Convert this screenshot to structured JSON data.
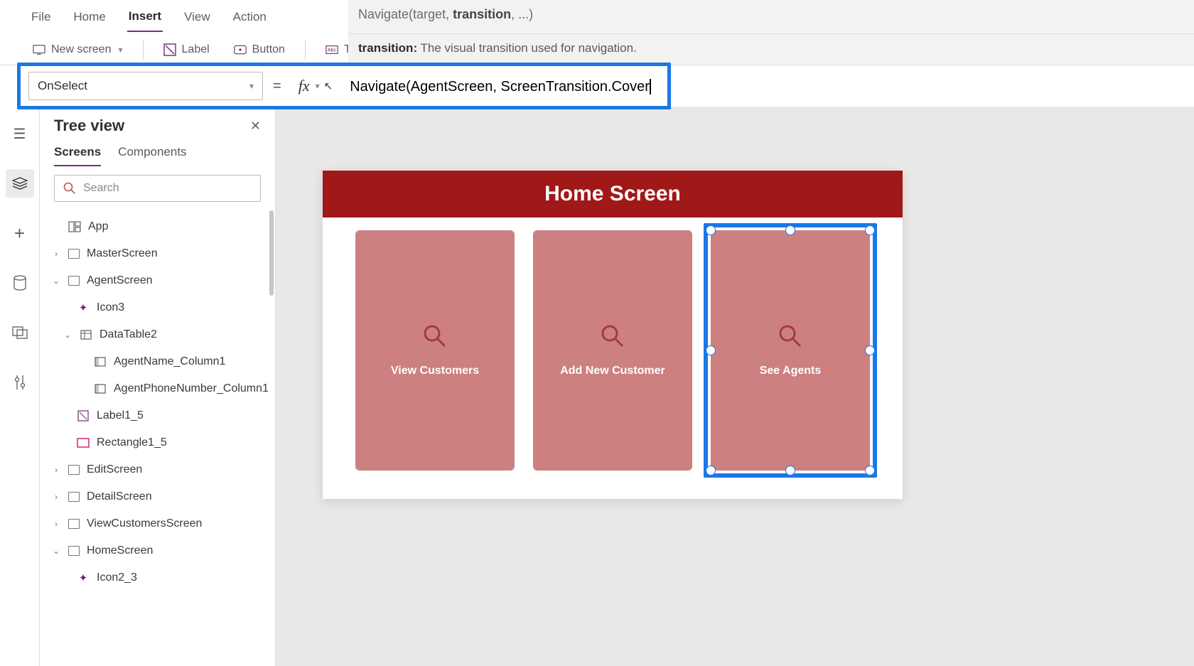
{
  "menu": {
    "file": "File",
    "home": "Home",
    "insert": "Insert",
    "view": "View",
    "action": "Action"
  },
  "ribbon": {
    "new_screen": "New screen",
    "label": "Label",
    "button": "Button",
    "text": "Text"
  },
  "formula_help": {
    "signature_fn": "Navigate",
    "signature_args_before": "(target, ",
    "signature_strong": "transition",
    "signature_after": ", ...)",
    "desc_strong": "transition:",
    "desc_text": " The visual transition used for navigation."
  },
  "property_selector": "OnSelect",
  "formula": "Navigate(AgentScreen, ScreenTransition.Cover",
  "tree_panel": {
    "title": "Tree view",
    "tabs": {
      "screens": "Screens",
      "components": "Components"
    },
    "search_placeholder": "Search",
    "items": {
      "app": "App",
      "master": "MasterScreen",
      "agent": "AgentScreen",
      "icon3": "Icon3",
      "datatable2": "DataTable2",
      "agentname": "AgentName_Column1",
      "agentphone": "AgentPhoneNumber_Column1",
      "label15": "Label1_5",
      "rect15": "Rectangle1_5",
      "edit": "EditScreen",
      "detail": "DetailScreen",
      "viewcust": "ViewCustomersScreen",
      "homescreen": "HomeScreen",
      "icon23": "Icon2_3"
    }
  },
  "canvas": {
    "header": "Home Screen",
    "card1": "View Customers",
    "card2": "Add New Customer",
    "card3": "See Agents"
  }
}
